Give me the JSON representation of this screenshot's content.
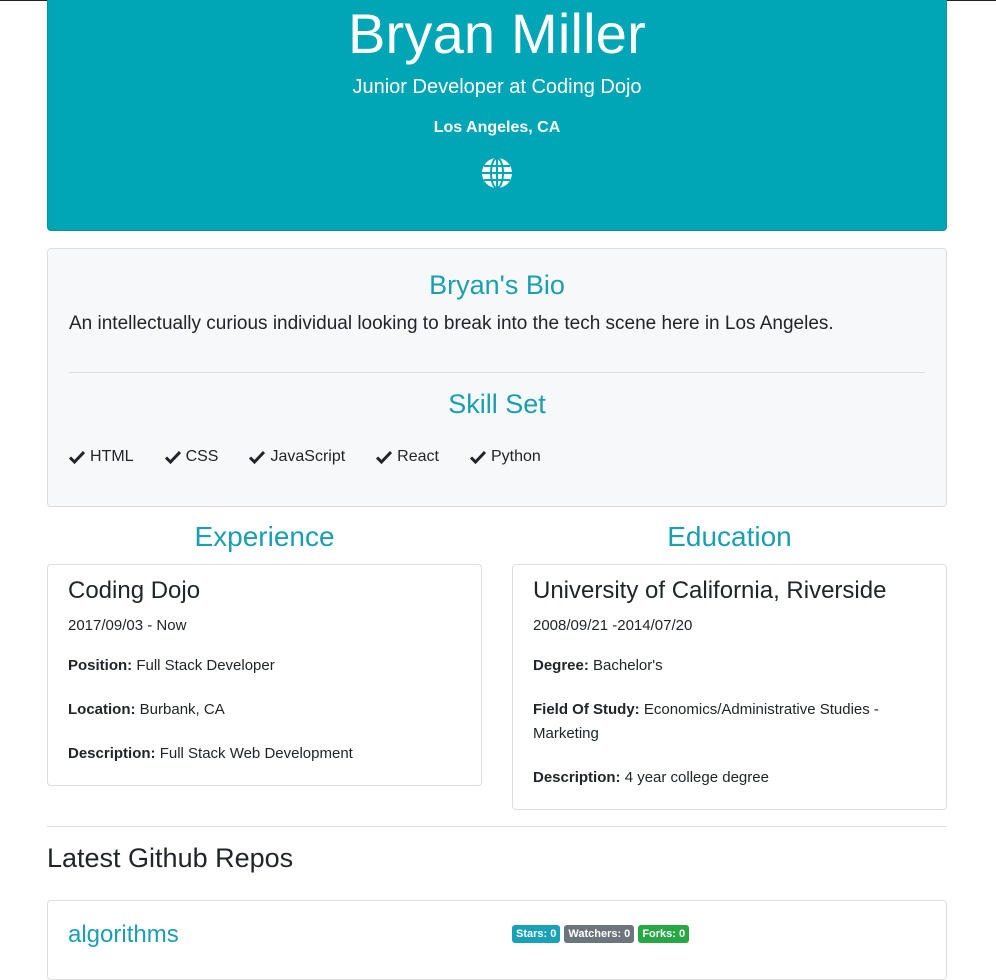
{
  "profile": {
    "name": "Bryan Miller",
    "title": "Junior Developer at Coding Dojo",
    "location": "Los Angeles, CA",
    "website_icon": "globe-icon"
  },
  "bio": {
    "heading": "Bryan's Bio",
    "text": "An intellectually curious individual looking to break into the tech scene here in Los Angeles.",
    "skills_heading": "Skill Set",
    "skills": [
      "HTML",
      "CSS",
      "JavaScript",
      "React",
      "Python"
    ]
  },
  "experience": {
    "heading": "Experience",
    "company": "Coding Dojo",
    "dates": "2017/09/03 - Now",
    "position_label": "Position:",
    "position": "Full Stack Developer",
    "location_label": "Location:",
    "location": "Burbank, CA",
    "description_label": "Description:",
    "description": "Full Stack Web Development"
  },
  "education": {
    "heading": "Education",
    "school": "University of California, Riverside",
    "dates": "2008/09/21 -2014/07/20",
    "degree_label": "Degree:",
    "degree": "Bachelor's",
    "field_label": "Field Of Study:",
    "field": "Economics/Administrative Studies - Marketing",
    "description_label": "Description:",
    "description": "4 year college degree"
  },
  "repos": {
    "heading": "Latest Github Repos",
    "items": [
      {
        "name": "algorithms",
        "stars": "Stars: 0",
        "watchers": "Watchers: 0",
        "forks": "Forks: 0"
      }
    ]
  },
  "colors": {
    "primary": "#00a6b6",
    "accent_text": "#1a9fb0",
    "stars_badge": "#17a2b8",
    "watchers_badge": "#6c757d",
    "forks_badge": "#28a745"
  }
}
